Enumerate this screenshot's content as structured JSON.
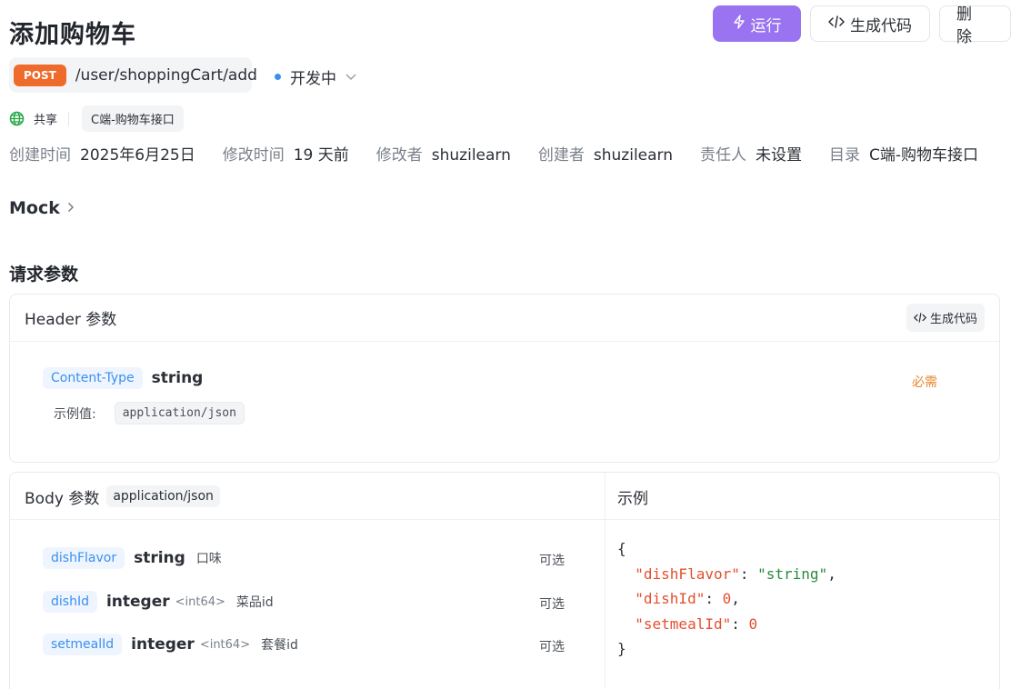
{
  "page": {
    "title": "添加购物车"
  },
  "actions": {
    "run_label": "运行",
    "gen_label": "生成代码",
    "delete_label": "删 除"
  },
  "endpoint": {
    "method": "POST",
    "path": "/user/shoppingCart/add",
    "status": "开发中"
  },
  "meta": {
    "share_label": "共享",
    "folder_tag": "C端-购物车接口"
  },
  "info": [
    {
      "key": "创建时间",
      "value": "2025年6月25日"
    },
    {
      "key": "修改时间",
      "value": "19 天前"
    },
    {
      "key": "修改者",
      "value": "shuzilearn"
    },
    {
      "key": "创建者",
      "value": "shuzilearn"
    },
    {
      "key": "责任人",
      "value": "未设置"
    },
    {
      "key": "目录",
      "value": "C端-购物车接口"
    }
  ],
  "mock": {
    "label": "Mock"
  },
  "request": {
    "title": "请求参数",
    "header": {
      "title": "Header 参数",
      "gen_label": "生成代码",
      "param": {
        "name": "Content-Type",
        "type": "string",
        "required": "必需",
        "example_label": "示例值:",
        "example_value": "application/json"
      }
    },
    "body": {
      "title": "Body 参数",
      "format": "application/json",
      "example_title": "示例",
      "params": [
        {
          "name": "dishFlavor",
          "type": "string",
          "format": "",
          "desc": "口味",
          "optional": "可选"
        },
        {
          "name": "dishId",
          "type": "integer",
          "format": "<int64>",
          "desc": "菜品id",
          "optional": "可选"
        },
        {
          "name": "setmealId",
          "type": "integer",
          "format": "<int64>",
          "desc": "套餐id",
          "optional": "可选"
        }
      ],
      "code": {
        "open": "{",
        "lines": [
          {
            "key": "\"dishFlavor\"",
            "value": "\"string\"",
            "tail": ","
          },
          {
            "key": "\"dishId\"",
            "value": "0",
            "tail": ","
          },
          {
            "key": "\"setmealId\"",
            "value": "0",
            "tail": ""
          }
        ],
        "close": "}"
      }
    }
  },
  "colors": {
    "accent": "#9a73f0",
    "post": "#ef6b2b",
    "param": "#3b8ff0",
    "required": "#e8872c"
  }
}
